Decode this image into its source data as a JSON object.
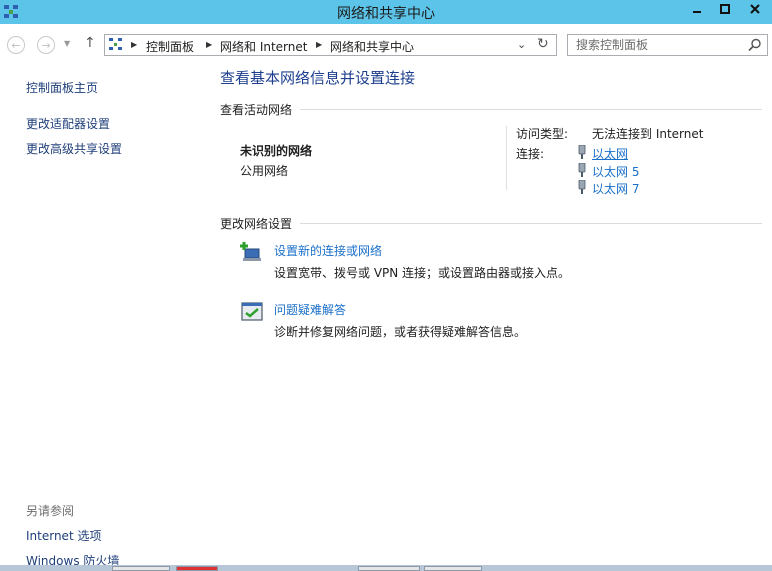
{
  "window": {
    "title": "网络和共享中心",
    "controls": {
      "minimize_icon": "minimize-icon",
      "maximize_icon": "maximize-icon",
      "close_icon": "close-icon"
    }
  },
  "nav": {
    "breadcrumb": [
      "控制面板",
      "网络和 Internet",
      "网络和共享中心"
    ],
    "search_placeholder": "搜索控制面板"
  },
  "sidebar": {
    "links": [
      "控制面板主页",
      "更改适配器设置",
      "更改高级共享设置"
    ],
    "see_also_title": "另请参阅",
    "see_also_links": [
      "Internet 选项",
      "Windows 防火墙"
    ]
  },
  "main": {
    "title": "查看基本网络信息并设置连接",
    "active_section": "查看活动网络",
    "network": {
      "name": "未识别的网络",
      "type": "公用网络",
      "access_label": "访问类型:",
      "access_value": "无法连接到 Internet",
      "connections_label": "连接:",
      "connections": [
        "以太网",
        "以太网 5",
        "以太网 7"
      ]
    },
    "change_section": "更改网络设置",
    "tasks": [
      {
        "link": "设置新的连接或网络",
        "desc": "设置宽带、拨号或 VPN 连接；或设置路由器或接入点。",
        "icon": "new-connection-icon"
      },
      {
        "link": "问题疑难解答",
        "desc": "诊断并修复网络问题，或者获得疑难解答信息。",
        "icon": "troubleshoot-icon"
      }
    ]
  },
  "colors": {
    "titlebar": "#5cc4e8",
    "link": "#1a6fc9",
    "heading": "#1e3f8f"
  }
}
